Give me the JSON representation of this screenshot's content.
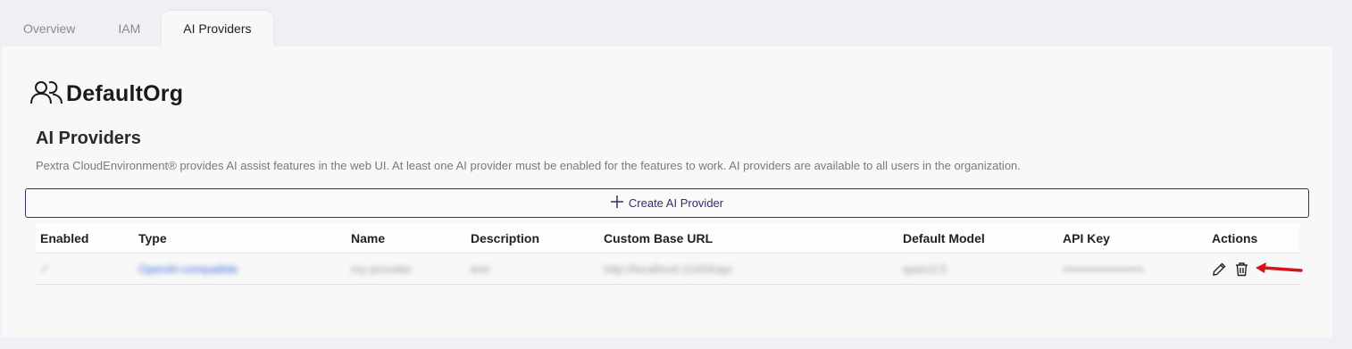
{
  "tabs": [
    {
      "label": "Overview",
      "active": false
    },
    {
      "label": "IAM",
      "active": false
    },
    {
      "label": "AI Providers",
      "active": true
    }
  ],
  "org": {
    "name": "DefaultOrg",
    "icon": "users-icon"
  },
  "section": {
    "title": "AI Providers",
    "description": "Pextra CloudEnvironment® provides AI assist features in the web UI. At least one AI provider must be enabled for the features to work. AI providers are available to all users in the organization."
  },
  "create_button": {
    "label": "Create AI Provider",
    "icon": "plus-icon"
  },
  "table": {
    "columns": [
      "Enabled",
      "Type",
      "Name",
      "Description",
      "Custom Base URL",
      "Default Model",
      "API Key",
      "Actions"
    ],
    "rows": [
      {
        "enabled": "✓",
        "type": "OpenAI-compatible",
        "name": "my-provider",
        "description": "test",
        "base_url": "http://localhost:11434/api",
        "default_model": "qwen2.5",
        "api_key": "••••••••••••••••••••",
        "actions": [
          "pencil-icon",
          "trash-icon"
        ]
      }
    ]
  },
  "annotation": {
    "icon": "red-arrow-icon",
    "color": "#d6141c"
  },
  "colors": {
    "accent": "#3b2a6e",
    "link": "#3d6fd8"
  }
}
